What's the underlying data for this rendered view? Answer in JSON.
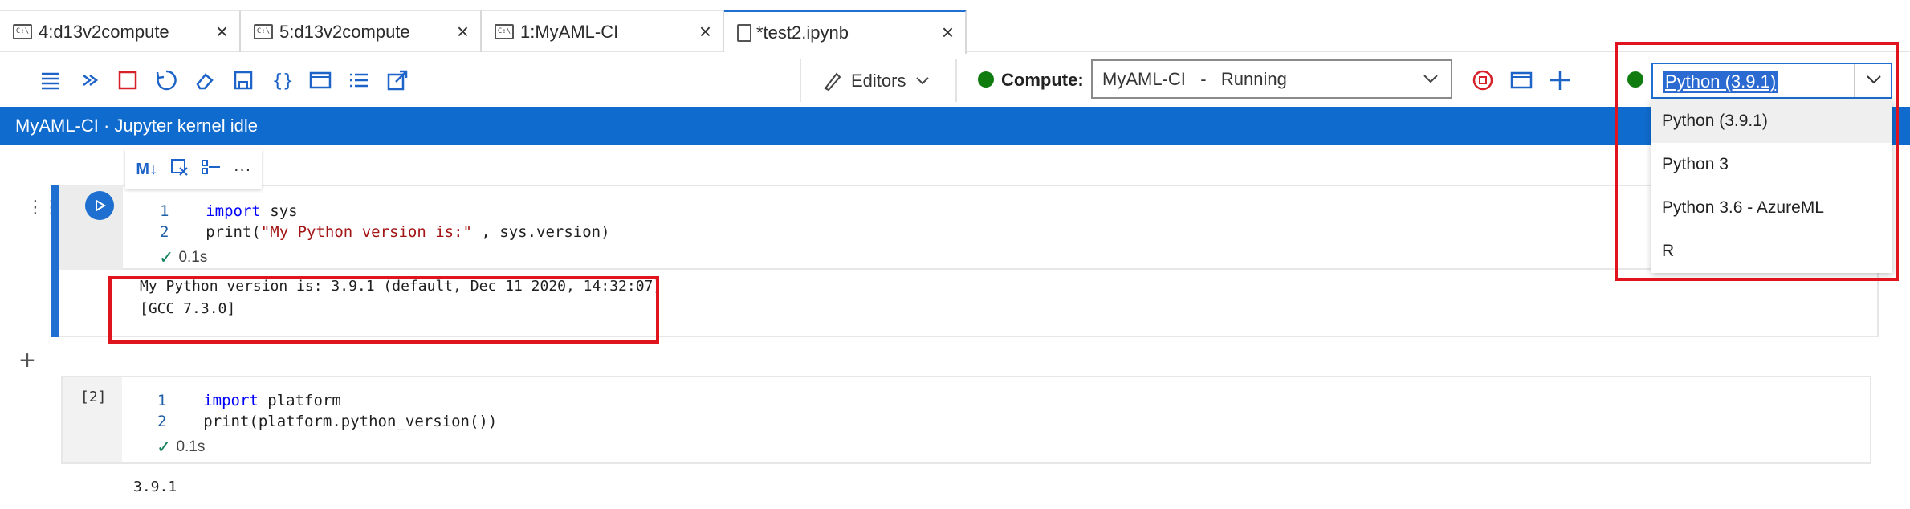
{
  "tabs": [
    {
      "label": "4:d13v2compute",
      "icon": "terminal-icon"
    },
    {
      "label": "5:d13v2compute",
      "icon": "terminal-icon"
    },
    {
      "label": "1:MyAML-CI",
      "icon": "terminal-icon"
    },
    {
      "label": "*test2.ipynb",
      "icon": "notebook-file-icon",
      "active": true
    }
  ],
  "toolbar": {
    "editors_label": "Editors",
    "compute_label": "Compute:",
    "compute_value": "MyAML-CI   -   Running",
    "compute_status_color": "#107c10",
    "kernel_status_color": "#107c10",
    "kernel_value": "Python (3.9.1)",
    "kernel_options": [
      "Python (3.9.1)",
      "Python 3",
      "Python 3.6 - AzureML",
      "R"
    ]
  },
  "status_bar": {
    "text": "MyAML-CI · Jupyter kernel idle",
    "color": "#0f6bce"
  },
  "cell1": {
    "lines": [
      {
        "n": "1",
        "kw": "import",
        "rest": " sys"
      },
      {
        "n": "2",
        "pre": "print(",
        "str": "\"My Python version is:\"",
        "post": " , sys.version)"
      }
    ],
    "exec_time": "0.1s",
    "output": [
      "My Python version is: 3.9.1 (default, Dec 11 2020, 14:32:07)",
      "[GCC 7.3.0]"
    ]
  },
  "cell2": {
    "exec_count": "[2]",
    "lines": [
      {
        "n": "1",
        "kw": "import",
        "rest": " platform"
      },
      {
        "n": "2",
        "pre": "print(platform.python_version())"
      }
    ],
    "exec_time": "0.1s",
    "output": "3.9.1"
  },
  "highlight_color": "#e0141e"
}
